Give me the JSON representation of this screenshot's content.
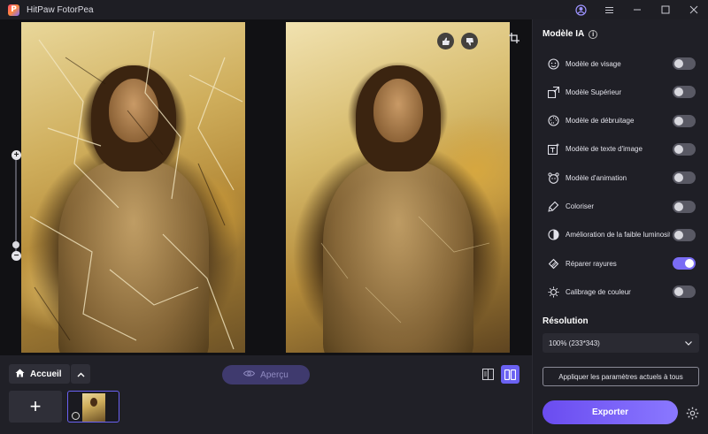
{
  "app": {
    "title": "HitPaw FotorPea",
    "logo_letter": "P"
  },
  "viewer": {
    "zoom_plus": "+",
    "zoom_minus": "−"
  },
  "bottombar": {
    "home_label": "Accueil",
    "preview_label": "Aperçu",
    "add_label": "+"
  },
  "panel": {
    "title": "Modèle IA",
    "info": "i",
    "models": [
      {
        "label": "Modèle de visage",
        "icon": "face-icon",
        "enabled": false
      },
      {
        "label": "Modèle Supérieur",
        "icon": "upscale-icon",
        "enabled": false
      },
      {
        "label": "Modèle de débruitage",
        "icon": "denoise-icon",
        "enabled": false
      },
      {
        "label": "Modèle de texte d'image",
        "icon": "text-image-icon",
        "enabled": false
      },
      {
        "label": "Modèle d'animation",
        "icon": "animation-icon",
        "enabled": false
      },
      {
        "label": "Coloriser",
        "icon": "colorize-icon",
        "enabled": false
      },
      {
        "label": "Amélioration de la faible luminosité",
        "icon": "low-light-icon",
        "enabled": false
      },
      {
        "label": "Réparer rayures",
        "icon": "scratch-repair-icon",
        "enabled": true
      },
      {
        "label": "Calibrage de couleur",
        "icon": "color-calibration-icon",
        "enabled": false
      }
    ],
    "resolution_title": "Résolution",
    "resolution_value": "100% (233*343)",
    "apply_all_label": "Appliquer les paramètres actuels à tous",
    "export_label": "Exporter"
  },
  "colors": {
    "accent": "#6a61f2",
    "toggle_on": "#7a6cf4",
    "toggle_off": "#595964",
    "panel_bg": "#1f1f26"
  }
}
